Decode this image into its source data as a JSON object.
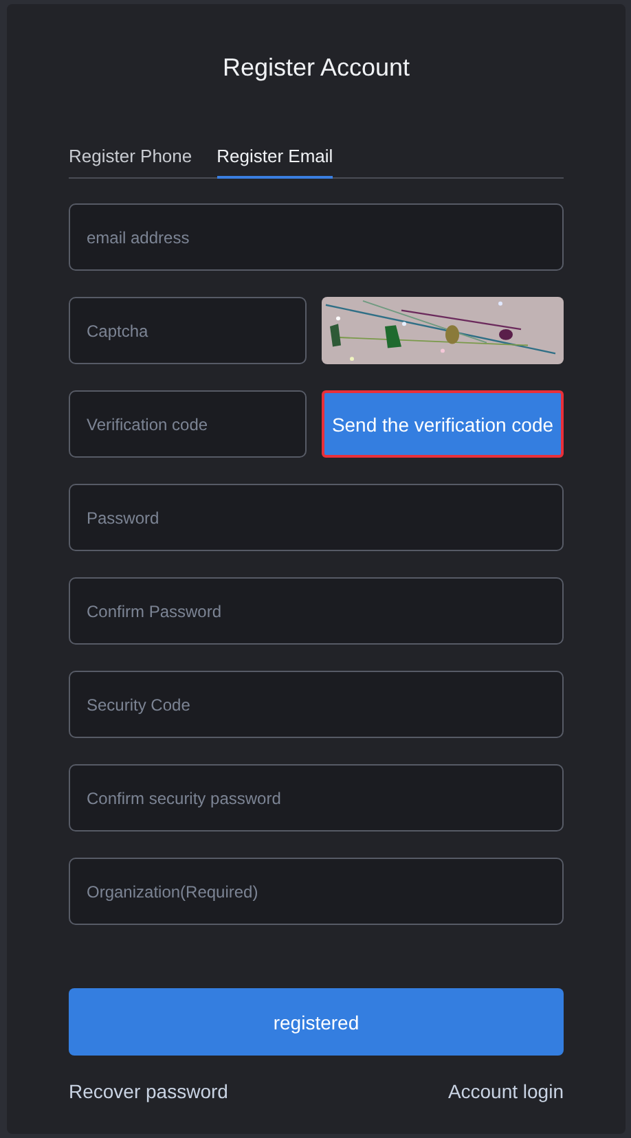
{
  "title": "Register Account",
  "tabs": [
    {
      "label": "Register Phone",
      "selected": false
    },
    {
      "label": "Register Email",
      "selected": true
    }
  ],
  "fields": [
    {
      "kind": "input",
      "placeholder": "email address"
    },
    {
      "kind": "captcha",
      "placeholder": "Captcha"
    },
    {
      "kind": "code",
      "placeholder": "Verification code",
      "button": {
        "label": "Send the verification code",
        "focused": true
      }
    },
    {
      "kind": "input",
      "placeholder": "Password"
    },
    {
      "kind": "input",
      "placeholder": "Confirm Password"
    },
    {
      "kind": "input",
      "placeholder": "Security Code"
    },
    {
      "kind": "input",
      "placeholder": "Confirm security password"
    },
    {
      "kind": "input",
      "placeholder": "Organization(Required)"
    }
  ],
  "submit": "registered",
  "links": [
    "Recover password",
    "Account login"
  ]
}
